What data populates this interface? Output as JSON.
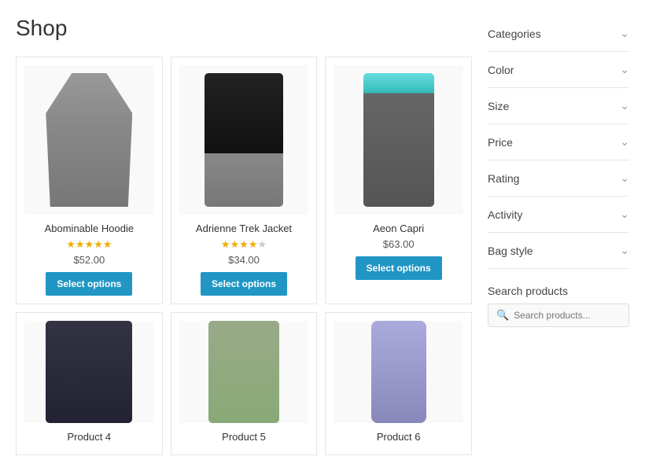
{
  "page": {
    "title": "Shop"
  },
  "filters": [
    {
      "id": "categories",
      "label": "Categories"
    },
    {
      "id": "color",
      "label": "Color"
    },
    {
      "id": "size",
      "label": "Size"
    },
    {
      "id": "price",
      "label": "Price"
    },
    {
      "id": "rating",
      "label": "Rating"
    },
    {
      "id": "activity",
      "label": "Activity"
    },
    {
      "id": "bag-style",
      "label": "Bag style"
    }
  ],
  "search": {
    "title": "Search products",
    "placeholder": "Search products...",
    "icon": "🔍"
  },
  "products": [
    {
      "name": "Abominable Hoodie",
      "price": "$52.00",
      "rating": 5,
      "max_rating": 5,
      "img_class": "img-hoodie",
      "btn_label": "Select options"
    },
    {
      "name": "Adrienne Trek Jacket",
      "price": "$34.00",
      "rating": 4,
      "max_rating": 5,
      "img_class": "img-jacket",
      "btn_label": "Select options"
    },
    {
      "name": "Aeon Capri",
      "price": "$63.00",
      "rating": 0,
      "max_rating": 5,
      "img_class": "img-capri",
      "btn_label": "Select options"
    },
    {
      "name": "Product 4",
      "price": "",
      "rating": 0,
      "max_rating": 5,
      "img_class": "img-shirt2",
      "btn_label": ""
    },
    {
      "name": "Product 5",
      "price": "",
      "rating": 0,
      "max_rating": 5,
      "img_class": "img-pants",
      "btn_label": ""
    },
    {
      "name": "Product 6",
      "price": "",
      "rating": 0,
      "max_rating": 5,
      "img_class": "img-bottle",
      "btn_label": ""
    }
  ]
}
